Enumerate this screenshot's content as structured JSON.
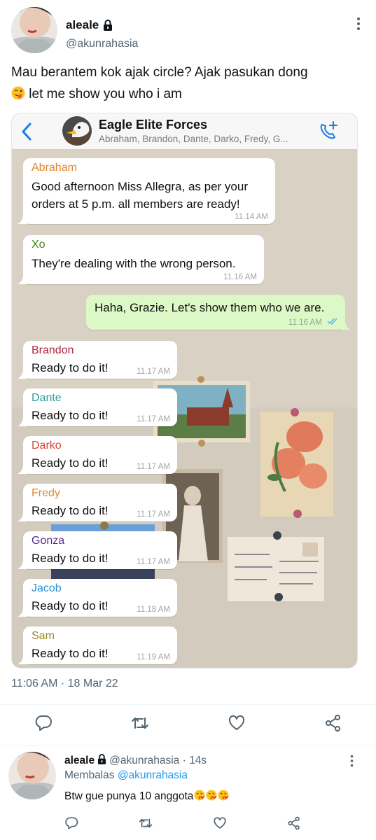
{
  "tweet": {
    "display_name": "aleale",
    "handle": "@akunrahasia",
    "text_line1": "Mau berantem kok ajak circle? Ajak pasukan dong",
    "text_line2": "let me show you who i am",
    "timestamp": "11:06 AM · 18 Mar 22"
  },
  "chat": {
    "group_name": "Eagle Elite Forces",
    "members": "Abraham, Brandon, Dante, Darko, Fredy, G...",
    "messages": [
      {
        "sender": "Abraham",
        "color": "#e0862c",
        "line1": "Good afternoon Miss Allegra, as per your",
        "line2": "orders at 5 p.m. all members are ready!",
        "time": "11.14 AM"
      },
      {
        "sender": "Xo",
        "color": "#3c8a12",
        "line1": "They're dealing with the wrong person.",
        "time": "11.16 AM"
      },
      {
        "outgoing": true,
        "line1": "Haha, Grazie. Let's show them who we are.",
        "time": "11.16 AM"
      },
      {
        "sender": "Brandon",
        "color": "#b3263a",
        "line1": "Ready to do it!",
        "time": "11.17 AM"
      },
      {
        "sender": "Dante",
        "color": "#2f9e9b",
        "line1": "Ready to do it!",
        "time": "11.17 AM"
      },
      {
        "sender": "Darko",
        "color": "#d4483a",
        "line1": "Ready to do it!",
        "time": "11.17 AM"
      },
      {
        "sender": "Fredy",
        "color": "#e3872b",
        "line1": "Ready to do it!",
        "time": "11.17 AM"
      },
      {
        "sender": "Gonza",
        "color": "#5b2b8c",
        "line1": "Ready to do it!",
        "time": "11.17 AM"
      },
      {
        "sender": "Jacob",
        "color": "#2b8fd6",
        "line1": "Ready to do it!",
        "time": "11.18 AM"
      },
      {
        "sender": "Sam",
        "color": "#9a8a2a",
        "line1": "Ready to do it!",
        "time": "11.19 AM"
      }
    ]
  },
  "actions": [
    "reply-icon",
    "retweet-icon",
    "like-icon",
    "share-icon"
  ],
  "reply": {
    "display_name": "aleale",
    "meta": "@akunrahasia · 14s",
    "replying_label": "Membalas",
    "replying_to": "@akunrahasia",
    "text": "Btw gue punya 10 anggota"
  },
  "colors": {
    "link": "#1d9bf0",
    "secondary_text": "#536471",
    "outgoing_bubble": "#dcf8c6",
    "whatsapp_blue": "#1a7ce8"
  }
}
